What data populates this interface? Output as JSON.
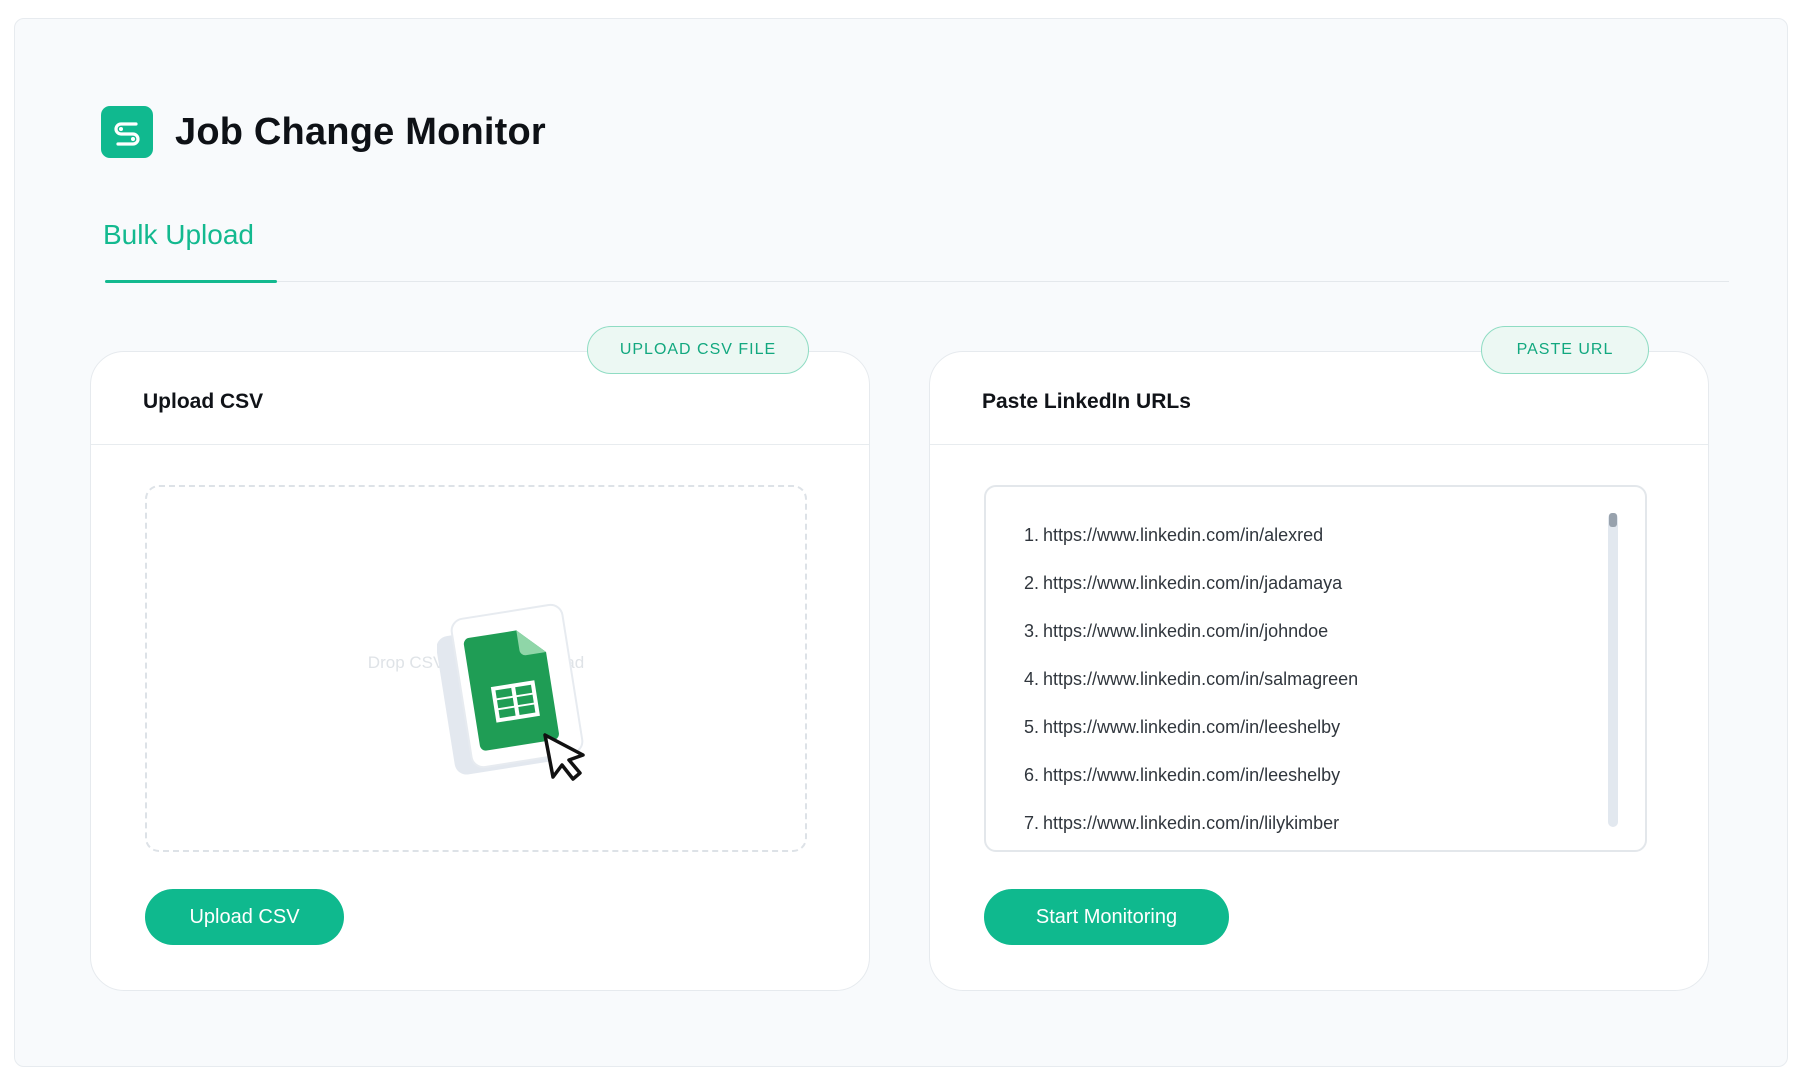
{
  "app": {
    "title": "Job Change Monitor",
    "logo_icon": "s-logo-icon",
    "accent_color": "#10b98f"
  },
  "tabs": [
    {
      "label": "Bulk Upload",
      "active": true
    }
  ],
  "upload_card": {
    "badge": "UPLOAD CSV FILE",
    "title": "Upload CSV",
    "drop_text": "Drop CSV file here to upload",
    "illustration_icon": "google-sheets-icon",
    "button": "Upload CSV"
  },
  "paste_card": {
    "badge": "PASTE URL",
    "title": "Paste LinkedIn URLs",
    "urls": [
      {
        "num": "1.",
        "url": "https://www.linkedin.com/in/alexred"
      },
      {
        "num": "2.",
        "url": "https://www.linkedin.com/in/jadamaya"
      },
      {
        "num": "3.",
        "url": "https://www.linkedin.com/in/johndoe"
      },
      {
        "num": "4.",
        "url": "https://www.linkedin.com/in/salmagreen"
      },
      {
        "num": "5.",
        "url": "https://www.linkedin.com/in/leeshelby"
      },
      {
        "num": "6.",
        "url": "https://www.linkedin.com/in/leeshelby"
      },
      {
        "num": "7.",
        "url": "https://www.linkedin.com/in/lilykimber"
      }
    ],
    "button": "Start Monitoring"
  }
}
